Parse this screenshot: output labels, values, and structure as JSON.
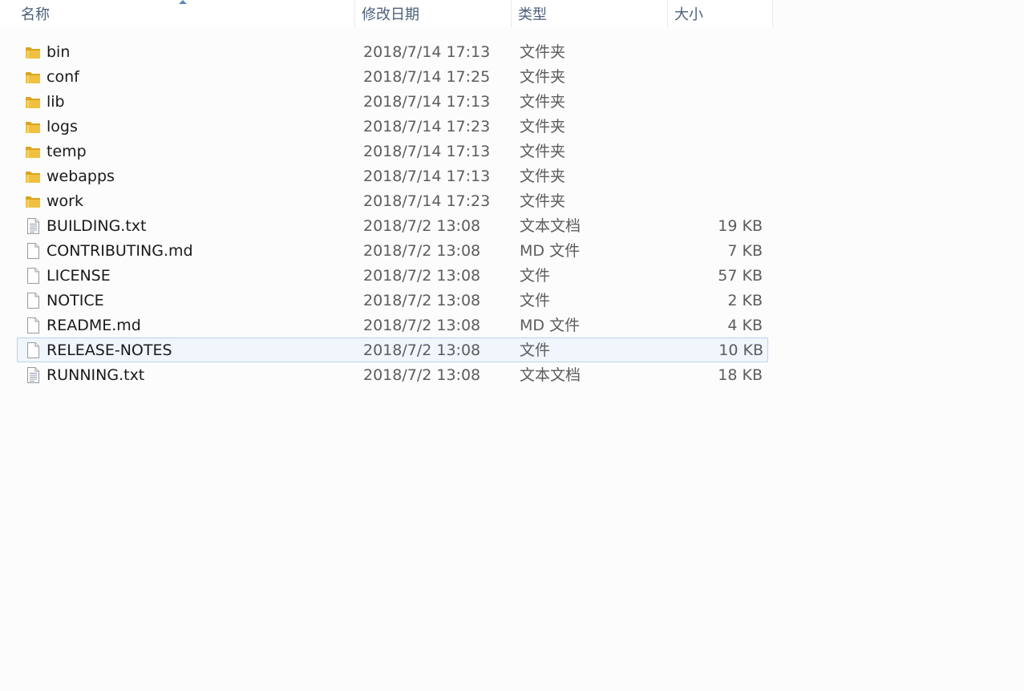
{
  "columns": {
    "name": "名称",
    "date": "修改日期",
    "type": "类型",
    "size": "大小"
  },
  "files": [
    {
      "name": "bin",
      "date": "2018/7/14 17:13",
      "type": "文件夹",
      "size": "",
      "icon": "folder-icon"
    },
    {
      "name": "conf",
      "date": "2018/7/14 17:25",
      "type": "文件夹",
      "size": "",
      "icon": "folder-icon"
    },
    {
      "name": "lib",
      "date": "2018/7/14 17:13",
      "type": "文件夹",
      "size": "",
      "icon": "folder-icon"
    },
    {
      "name": "logs",
      "date": "2018/7/14 17:23",
      "type": "文件夹",
      "size": "",
      "icon": "folder-icon"
    },
    {
      "name": "temp",
      "date": "2018/7/14 17:13",
      "type": "文件夹",
      "size": "",
      "icon": "folder-icon"
    },
    {
      "name": "webapps",
      "date": "2018/7/14 17:13",
      "type": "文件夹",
      "size": "",
      "icon": "folder-icon"
    },
    {
      "name": "work",
      "date": "2018/7/14 17:23",
      "type": "文件夹",
      "size": "",
      "icon": "folder-icon"
    },
    {
      "name": "BUILDING.txt",
      "date": "2018/7/2 13:08",
      "type": "文本文档",
      "size": "19 KB",
      "icon": "text-document-icon"
    },
    {
      "name": "CONTRIBUTING.md",
      "date": "2018/7/2 13:08",
      "type": "MD 文件",
      "size": "7 KB",
      "icon": "file-icon"
    },
    {
      "name": "LICENSE",
      "date": "2018/7/2 13:08",
      "type": "文件",
      "size": "57 KB",
      "icon": "file-icon"
    },
    {
      "name": "NOTICE",
      "date": "2018/7/2 13:08",
      "type": "文件",
      "size": "2 KB",
      "icon": "file-icon"
    },
    {
      "name": "README.md",
      "date": "2018/7/2 13:08",
      "type": "MD 文件",
      "size": "4 KB",
      "icon": "file-icon"
    },
    {
      "name": "RELEASE-NOTES",
      "date": "2018/7/2 13:08",
      "type": "文件",
      "size": "10 KB",
      "icon": "file-icon",
      "selected": true
    },
    {
      "name": "RUNNING.txt",
      "date": "2018/7/2 13:08",
      "type": "文本文档",
      "size": "18 KB",
      "icon": "text-document-icon"
    }
  ],
  "colors": {
    "header_text": "#4c607a",
    "selection_bg": "#f0f6fc",
    "selection_border": "#b9d3ec",
    "folder": "#f0c040"
  }
}
